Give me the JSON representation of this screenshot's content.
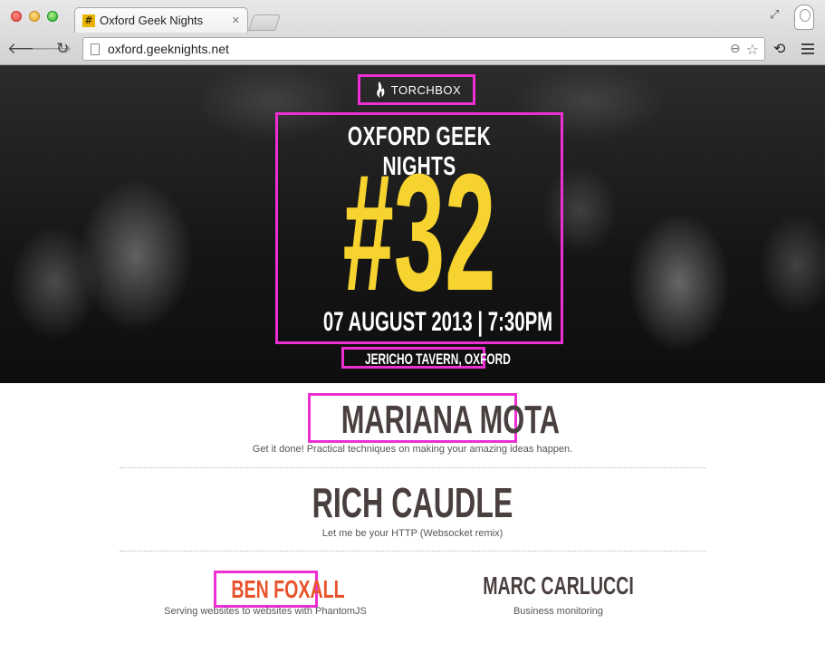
{
  "browser": {
    "tab_title": "Oxford Geek Nights",
    "tab_favicon": "#",
    "tab_close": "✕",
    "url": "oxford.geeknights.net"
  },
  "hero": {
    "sponsor": "TORCHBOX",
    "title": "OXFORD GEEK NIGHTS",
    "number": "#32",
    "datetime": "07 AUGUST 2013 | 7:30PM",
    "venue": "JERICHO TAVERN, OXFORD"
  },
  "speakers": [
    {
      "name": "MARIANA MOTA",
      "talk": "Get it done! Practical techniques on making your amazing ideas happen."
    },
    {
      "name": "RICH CAUDLE",
      "talk": "Let me be your HTTP (Websocket remix)"
    },
    {
      "name": "BEN FOXALL",
      "talk": "Serving websites to websites with PhantomJS"
    },
    {
      "name": "MARC CARLUCCI",
      "talk": "Business monitoring"
    }
  ],
  "colors": {
    "accent_yellow": "#f7d32f",
    "highlight_magenta": "#ec2ed3",
    "link_orange": "#e8532b",
    "name_dark": "#4a3f3f"
  },
  "icons": [
    "back-arrow-icon",
    "forward-arrow-icon",
    "reload-icon",
    "page-icon",
    "zoom-icon",
    "star-icon",
    "extension-icon",
    "menu-icon",
    "torch-icon",
    "resize-icon",
    "profile-icon"
  ]
}
